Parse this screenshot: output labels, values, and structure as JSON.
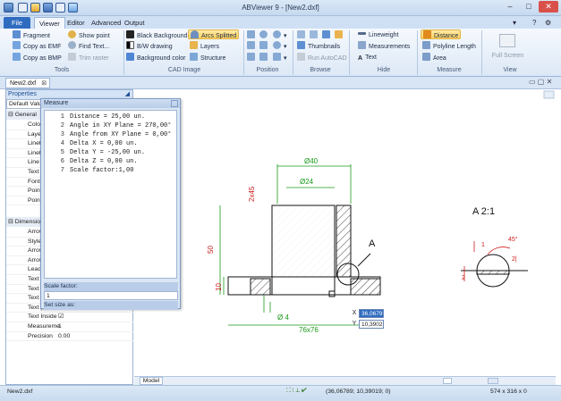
{
  "window": {
    "title": "ABViewer 9 - [New2.dxf]",
    "min": "–",
    "max": "□",
    "close": "✕"
  },
  "tabs": {
    "file": "File",
    "viewer": "Viewer",
    "editor": "Editor",
    "advanced": "Advanced",
    "output": "Output"
  },
  "ribbon": {
    "tools": {
      "label": "Tools",
      "fragment": "Fragment",
      "copy_emf": "Copy as EMF",
      "copy_bmp": "Copy as BMP",
      "show_point": "Show point",
      "find_text": "Find Text...",
      "trim_raster": "Trim raster"
    },
    "cad_image": {
      "label": "CAD Image",
      "black_bg": "Black Background",
      "bw": "B/W drawing",
      "bg_color": "Background color",
      "arcs_splitted": "Arcs Splitted",
      "layers": "Layers",
      "structure": "Structure"
    },
    "position": {
      "label": "Position"
    },
    "browse": {
      "label": "Browse",
      "thumbnails": "Thumbnails",
      "run_autocad": "Run AutoCAD"
    },
    "hide": {
      "label": "Hide",
      "lineweight": "Lineweight",
      "measurements": "Measurements",
      "text": "Text"
    },
    "measure": {
      "label": "Measure",
      "distance": "Distance",
      "polyline_length": "Polyline Length",
      "area": "Area"
    },
    "view": {
      "label": "View",
      "full_screen": "Full Screen"
    }
  },
  "doc_tab": "New2.dxf",
  "properties": {
    "header": "Properties",
    "dropdown": "Default Valu",
    "general": "General",
    "rows": [
      {
        "key": "Color",
        "value": ""
      },
      {
        "key": "Layer",
        "value": ""
      },
      {
        "key": "Linetyp",
        "value": ""
      },
      {
        "key": "Linetyp",
        "value": ""
      },
      {
        "key": "Line W",
        "value": ""
      },
      {
        "key": "Text st",
        "value": ""
      },
      {
        "key": "Font",
        "value": ""
      },
      {
        "key": "Point m",
        "value": ""
      },
      {
        "key": "Point m",
        "value": ""
      }
    ],
    "dimension": "Dimension",
    "rows2": [
      {
        "key": "Arrow",
        "value": ""
      },
      {
        "key": "Style",
        "value": ""
      },
      {
        "key": "Arrow",
        "value": ""
      },
      {
        "key": "Arrow",
        "value": ""
      },
      {
        "key": "Leade",
        "value": ""
      },
      {
        "key": "Text",
        "value": ""
      },
      {
        "key": "Text",
        "value": ""
      },
      {
        "key": "Text",
        "value": ""
      },
      {
        "key": "Text pos ve",
        "value": "Center"
      },
      {
        "key": "Text Inside",
        "value": "☑"
      },
      {
        "key": "Measureme",
        "value": "1"
      },
      {
        "key": "Precision",
        "value": "0.00"
      }
    ]
  },
  "measure_dialog": {
    "title": "Measure",
    "lines": [
      {
        "n": "1",
        "t": "Distance = 25,00 un."
      },
      {
        "n": "2",
        "t": "Angle in XY Plane = 270,00°"
      },
      {
        "n": "3",
        "t": "Angle from XY Plane = 0,00°"
      },
      {
        "n": "4",
        "t": "Delta X = 0,00 un."
      },
      {
        "n": "5",
        "t": "Delta Y = -25,00 un."
      },
      {
        "n": "6",
        "t": "Delta Z = 0,00 un."
      },
      {
        "n": "7",
        "t": "Scale factor:1,00"
      }
    ],
    "scale_label": "Scale factor:",
    "scale_value": "1",
    "size_label": "Set size as:",
    "size_value": ""
  },
  "drawing": {
    "dims": {
      "d40": "Ø40",
      "d24": "Ø24",
      "chamfer": "2x45",
      "h50": "50",
      "h10": "10",
      "d4": "Ø 4",
      "w76": "76x76",
      "callout": "A",
      "detail": "A 2:1",
      "r45": "45°",
      "r21": "2|",
      "r1": "1",
      "d2": "2"
    },
    "coord_x_label": "X",
    "coord_x": "36,0679",
    "coord_y_label": "Y",
    "coord_y": "10,3902"
  },
  "bottom": {
    "model_tab": "Model"
  },
  "status": {
    "file": "New2.dxf",
    "coords": "(36,06789; 10,39019; 0)",
    "size": "574 x 316 x 0"
  },
  "colors": {
    "accent": "#2f6cc0",
    "drawing_green": "#1a9a1a",
    "drawing_red": "#cc1a1a",
    "ribbon": "#dce8f6"
  }
}
